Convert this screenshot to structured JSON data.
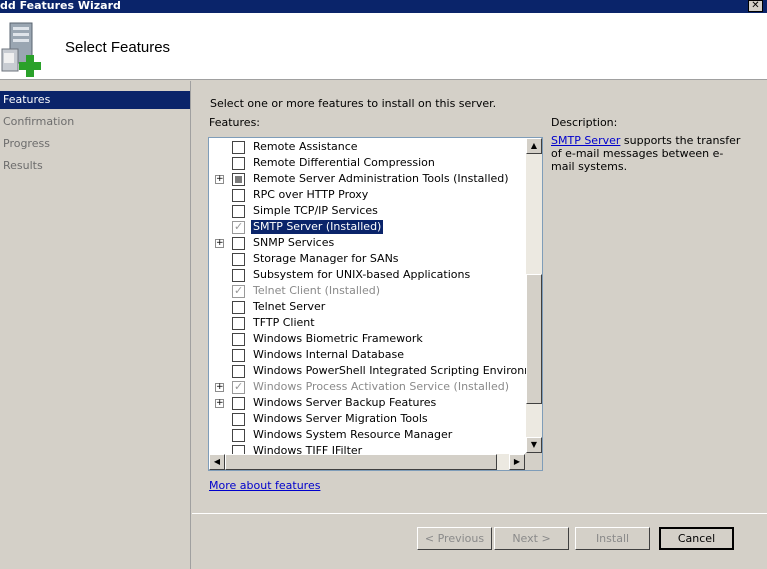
{
  "window": {
    "title": "dd Features Wizard"
  },
  "header": {
    "title": "Select Features"
  },
  "nav": {
    "items": [
      {
        "label": "Features",
        "active": true
      },
      {
        "label": "Confirmation",
        "active": false
      },
      {
        "label": "Progress",
        "active": false
      },
      {
        "label": "Results",
        "active": false
      }
    ]
  },
  "content": {
    "instruction": "Select one or more features to install on this server.",
    "features_label": "Features:",
    "description_label": "Description:",
    "description_link": "SMTP Server",
    "description_text": " supports the transfer of e-mail messages between e-mail systems.",
    "more_link": "More about features"
  },
  "features": [
    {
      "label": "Remote Assistance",
      "state": "unchecked",
      "expander": false,
      "style": "normal"
    },
    {
      "label": "Remote Differential Compression",
      "state": "unchecked",
      "expander": false,
      "style": "normal"
    },
    {
      "label": "Remote Server Administration Tools  (Installed)",
      "state": "partial",
      "expander": true,
      "style": "normal"
    },
    {
      "label": "RPC over HTTP Proxy",
      "state": "unchecked",
      "expander": false,
      "style": "normal"
    },
    {
      "label": "Simple TCP/IP Services",
      "state": "unchecked",
      "expander": false,
      "style": "normal"
    },
    {
      "label": "SMTP Server  (Installed)",
      "state": "checked-grey",
      "expander": false,
      "style": "selected"
    },
    {
      "label": "SNMP Services",
      "state": "unchecked",
      "expander": true,
      "style": "normal"
    },
    {
      "label": "Storage Manager for SANs",
      "state": "unchecked",
      "expander": false,
      "style": "normal"
    },
    {
      "label": "Subsystem for UNIX-based Applications",
      "state": "unchecked",
      "expander": false,
      "style": "normal"
    },
    {
      "label": "Telnet Client  (Installed)",
      "state": "checked-grey",
      "expander": false,
      "style": "grey"
    },
    {
      "label": "Telnet Server",
      "state": "unchecked",
      "expander": false,
      "style": "normal"
    },
    {
      "label": "TFTP Client",
      "state": "unchecked",
      "expander": false,
      "style": "normal"
    },
    {
      "label": "Windows Biometric Framework",
      "state": "unchecked",
      "expander": false,
      "style": "normal"
    },
    {
      "label": "Windows Internal Database",
      "state": "unchecked",
      "expander": false,
      "style": "normal"
    },
    {
      "label": "Windows PowerShell Integrated Scripting Environment (IS",
      "state": "unchecked",
      "expander": false,
      "style": "normal"
    },
    {
      "label": "Windows Process Activation Service  (Installed)",
      "state": "checked-grey",
      "expander": true,
      "style": "grey"
    },
    {
      "label": "Windows Server Backup Features",
      "state": "unchecked",
      "expander": true,
      "style": "normal"
    },
    {
      "label": "Windows Server Migration Tools",
      "state": "unchecked",
      "expander": false,
      "style": "normal"
    },
    {
      "label": "Windows System Resource Manager",
      "state": "unchecked",
      "expander": false,
      "style": "normal"
    },
    {
      "label": "Windows TIFF IFilter",
      "state": "unchecked",
      "expander": false,
      "style": "normal"
    }
  ],
  "buttons": {
    "previous": "< Previous",
    "next": "Next >",
    "install": "Install",
    "cancel": "Cancel"
  },
  "icons": {
    "close": "close-icon",
    "wizard": "server-add-icon",
    "expander": "plus-icon",
    "scroll_up": "arrow-up-icon",
    "scroll_down": "arrow-down-icon",
    "scroll_left": "arrow-left-icon",
    "scroll_right": "arrow-right-icon"
  }
}
